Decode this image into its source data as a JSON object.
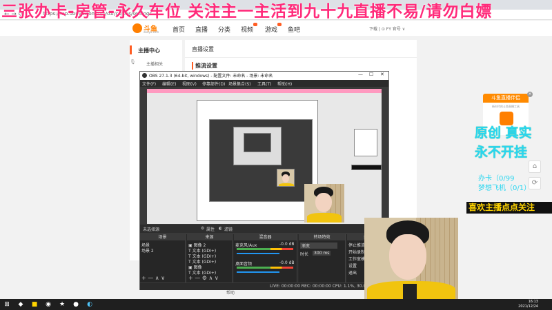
{
  "banner": {
    "text": "三张办卡-房管-永久车位 关注主一主活到九十九直播不易/请勿白嫖"
  },
  "browser": {
    "url": "https://mp.douyu.com/o/o/o#/cs/obs/settings"
  },
  "site": {
    "logo_text": "斗鱼",
    "logo_sub": "douyu.com",
    "nav": [
      "首页",
      "直播",
      "分类",
      "视频",
      "游戏",
      "鱼吧"
    ],
    "header_right": "下载  |  ⊙  FY 官号 ∨"
  },
  "sidebar": {
    "title": "主播中心",
    "item": "主播相关"
  },
  "content": {
    "title": "直播设置",
    "section": "推流设置",
    "bottom_label": "帮助"
  },
  "obs": {
    "title": "OBS 27.1.3 (64-bit, windows) - 配置文件: 未命名 - 场景: 未命名",
    "menu": [
      "文件(F)",
      "编辑(E)",
      "视图(V)",
      "停靠部件(D)",
      "场景集合(S)",
      "工具(T)",
      "帮助(H)"
    ],
    "ctrl_label_source": "未选择源",
    "ctrl_properties": "属性",
    "ctrl_filters": "滤镜",
    "docks": {
      "scenes": {
        "header": "场景",
        "items": [
          "场景",
          "场景 2"
        ]
      },
      "sources": {
        "header": "来源",
        "items": [
          "图像 2",
          "文本 (GDI+)",
          "文本 (GDI+)",
          "文本 (GDI+)",
          "图像",
          "文本 (GDI+)"
        ]
      },
      "mixer": {
        "header": "混音器",
        "ch1": "麦克风/Aux",
        "ch1_db": "-0.0 dB",
        "ch2": "桌面音频",
        "ch2_db": "-0.0 dB"
      },
      "transitions": {
        "header": "转场特效",
        "type": "渐变",
        "duration_label": "时长",
        "duration": "300 ms"
      },
      "controls": {
        "header": "控件",
        "buttons": [
          "停止推流",
          "开始录制",
          "工作室模式",
          "设置",
          "退出"
        ]
      }
    },
    "status": "LIVE: 00:00:00   REC: 00:00:00   CPU: 1.1%, 30.00 fps"
  },
  "overlay": {
    "ad_title": "斗鱼直播伴侣",
    "ad_sub": "新时代的斗鱼直播工具",
    "line1": "原创 真实",
    "line2": "永不开挂",
    "line3": "办卡（0/99",
    "line4": "梦想飞机（0/1）",
    "follow_text": "喜欢主播点点关注"
  },
  "taskbar": {
    "time": "16:13",
    "date": "2021/12/24"
  }
}
